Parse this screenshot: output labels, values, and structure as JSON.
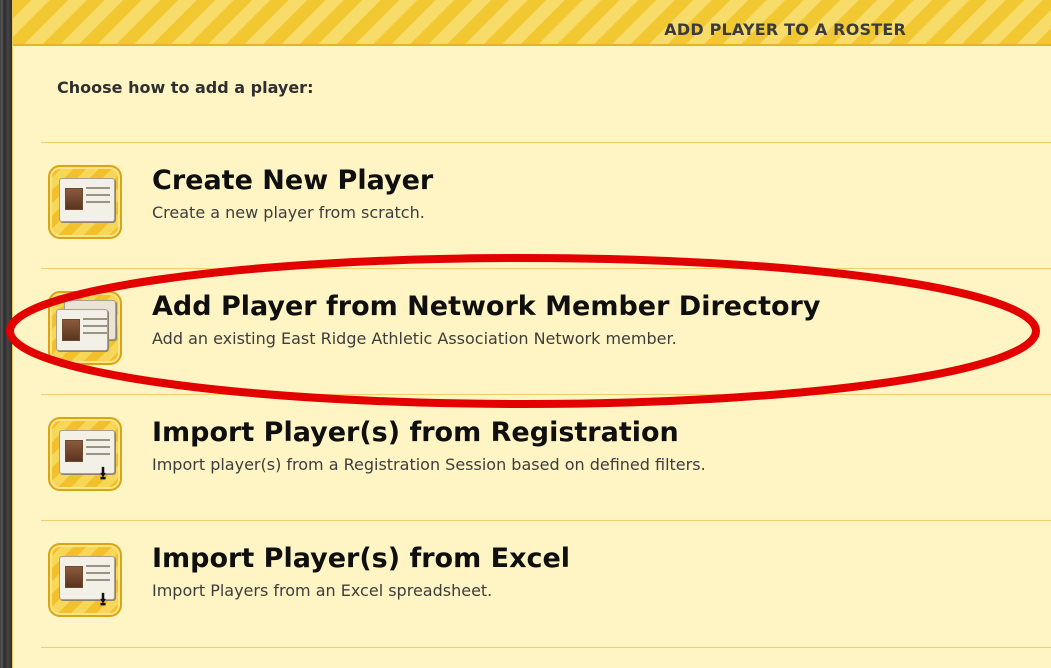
{
  "dialog": {
    "title": "ADD PLAYER TO A ROSTER",
    "prompt": "Choose how to add a player:"
  },
  "options": [
    {
      "title": "Create New Player",
      "description": "Create a new player from scratch.",
      "icon": "player-card-icon"
    },
    {
      "title": "Add Player from Network Member Directory",
      "description": "Add an existing East Ridge Athletic Association Network member.",
      "icon": "player-directory-icon",
      "highlighted": true
    },
    {
      "title": "Import Player(s) from Registration",
      "description": "Import player(s) from a Registration Session based on defined filters.",
      "icon": "player-import-icon"
    },
    {
      "title": "Import Player(s) from Excel",
      "description": "Import Players from an Excel spreadsheet.",
      "icon": "player-import-icon"
    }
  ],
  "colors": {
    "panel_background": "#fff4c4",
    "header_stripe": "#f2c832",
    "highlight_ellipse": "#e30000"
  }
}
